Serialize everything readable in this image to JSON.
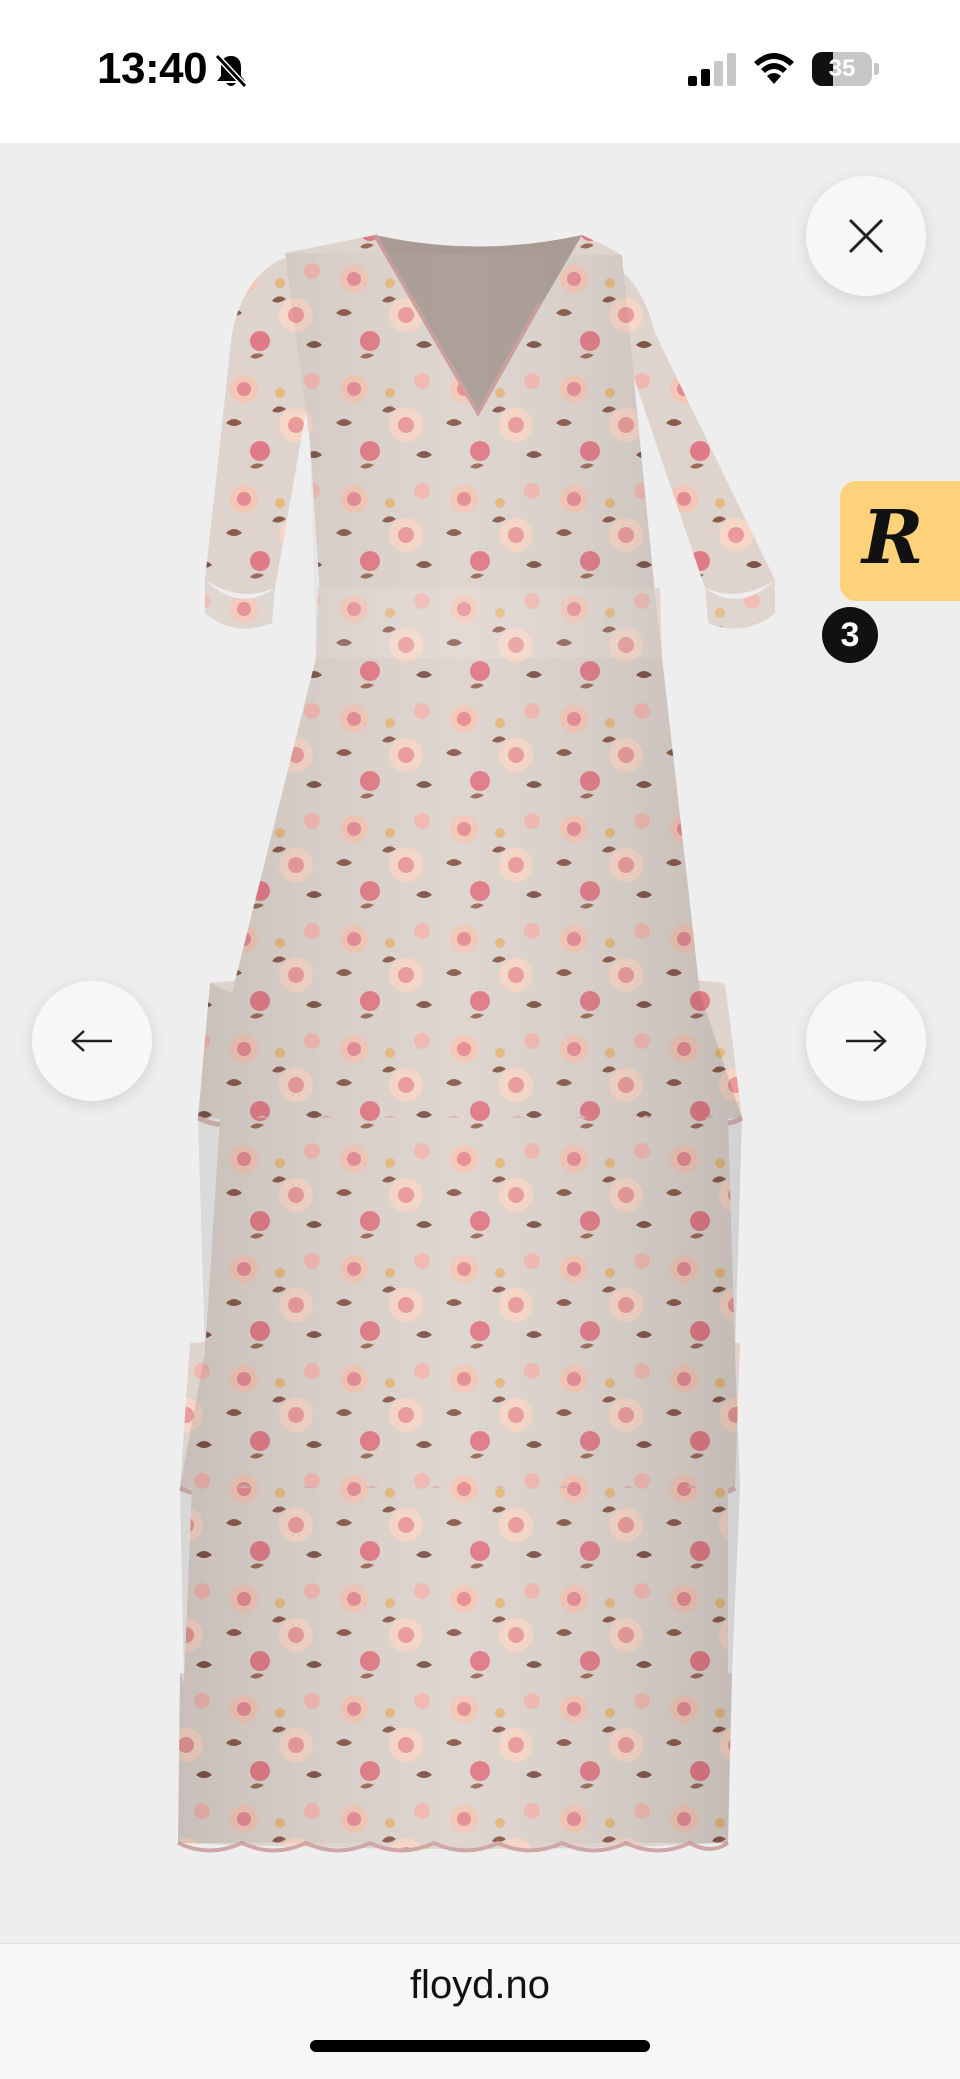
{
  "status_bar": {
    "time": "13:40",
    "battery_level": "35",
    "icons": [
      "bell-slash-icon",
      "cellular-signal-icon",
      "wifi-icon",
      "battery-icon"
    ]
  },
  "viewer": {
    "image_alt": "Floral tiered maxi dress",
    "close_icon": "close-icon",
    "prev_icon": "arrow-left-icon",
    "next_icon": "arrow-right-icon",
    "rewards_badge_count": "3",
    "rewards_logo_text": "R"
  },
  "browser": {
    "url": "floyd.no"
  },
  "colors": {
    "viewer_bg": "#efeeef",
    "dress_base": "#e8c9c5",
    "dress_floral_pink": "#e58b93",
    "dress_floral_blush": "#f2c0b4",
    "dress_leaf": "#8a5a4a",
    "rewards_tab": "#fdd27a"
  }
}
